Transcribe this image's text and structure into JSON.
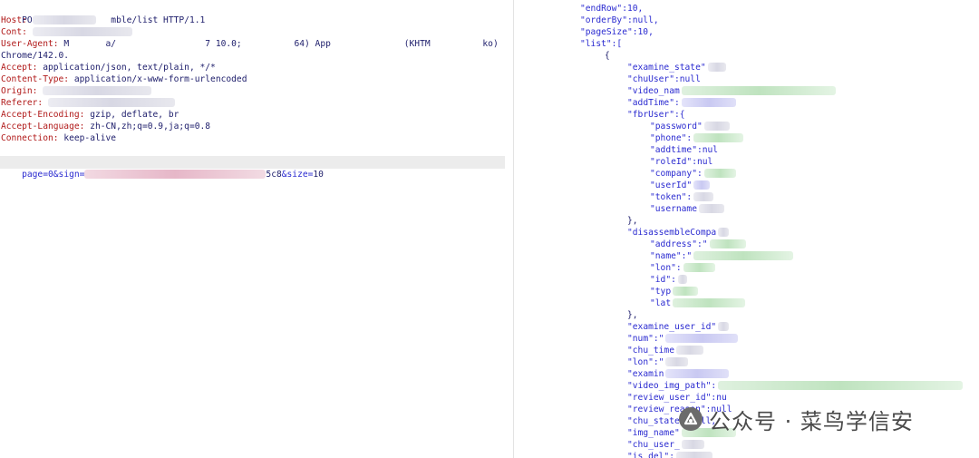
{
  "request": {
    "request_line": "POST /api/       mble/list HTTP/1.1",
    "headers": [
      {
        "name": "Host",
        "value": ""
      },
      {
        "name": "Cont",
        "value": ""
      },
      {
        "name": "User-Agent",
        "value": "M       a/                 7 10.0;          64) App              (KHTM          ko)"
      },
      {
        "name": "",
        "value": "Chrome/142.0."
      },
      {
        "name": "Accept",
        "value": "application/json, text/plain, */*"
      },
      {
        "name": "Content-Type",
        "value": "application/x-www-form-urlencoded"
      },
      {
        "name": "Origin",
        "value": ""
      },
      {
        "name": "Referer",
        "value": ""
      },
      {
        "name": "Accept-Encoding",
        "value": "gzip, deflate, br"
      },
      {
        "name": "Accept-Language",
        "value": "zh-CN,zh;q=0.9,ja;q=0.8"
      },
      {
        "name": "Connection",
        "value": "keep-alive"
      }
    ],
    "body": {
      "prefix": "page=0&sign=",
      "suffix": "5c8",
      "rest_key": "&size=",
      "rest_val": "10"
    }
  },
  "response": {
    "lines": [
      "\"endRow\":10,",
      "\"orderBy\":null,",
      "\"pageSize\":10,",
      "\"list\":[",
      "{",
      "\"examine_state\"",
      "\"chuUser\":null",
      "\"video_nam",
      "\"addTime\":",
      "\"fbrUser\":{",
      "\"password\"",
      "\"phone\":",
      "\"addtime\":nul",
      "\"roleId\":nul",
      "\"company\":",
      "\"userId\"",
      "\"token\":",
      "\"username",
      "},",
      "\"disassembleCompa",
      "\"address\":\"",
      "\"name\":\"",
      "\"lon\":",
      "\"id\":",
      "\"typ",
      "\"lat",
      "},",
      "\"examine_user_id\"",
      "\"num\":\"",
      "\"chu_time",
      "\"lon\":\"",
      "\"examin",
      "\"video_img_path\":",
      "\"review_user_id\":nu",
      "\"review_reason\":null",
      "\"chu_state\":null,",
      "\"img_name\"",
      "\"chu_user_",
      "\"is_del\":"
    ]
  },
  "watermark": {
    "text": "菜鸟学信安",
    "separator": "·",
    "icon": "wechat-official-account-icon"
  },
  "colors": {
    "header_key": "#b11a1a",
    "json_key": "#2a2ad0",
    "value": "#1d1d6b"
  }
}
